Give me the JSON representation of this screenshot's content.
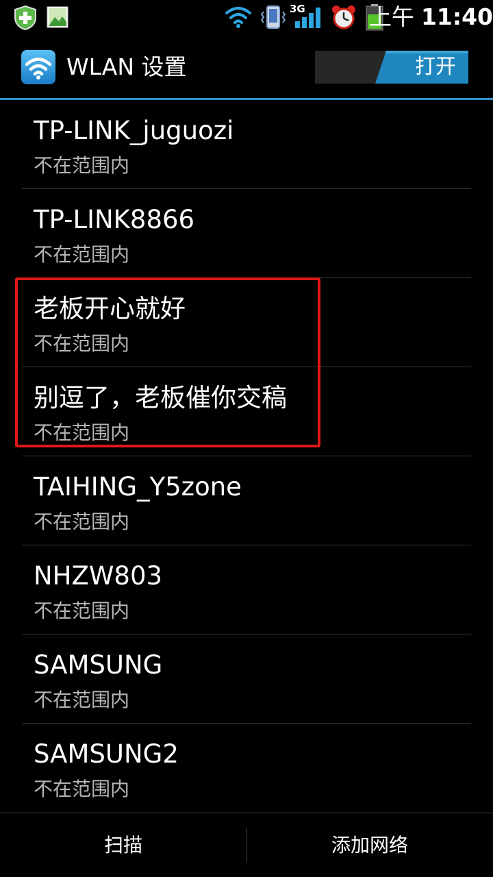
{
  "status_bar": {
    "ampm": "上午",
    "time": "11:40",
    "network_type": "3G",
    "icons": [
      "shield-update-icon",
      "image-notification-icon",
      "wifi-signal-icon",
      "vibrate-mode-icon",
      "cellular-signal-icon",
      "alarm-clock-icon",
      "battery-icon"
    ]
  },
  "action_bar": {
    "title": "WLAN 设置",
    "app_icon": "wifi-icon",
    "toggle_label": "打开",
    "toggle_state": "on"
  },
  "networks": [
    {
      "ssid": "TP-LINK_juguozi",
      "status": "不在范围内"
    },
    {
      "ssid": "TP-LINK8866",
      "status": "不在范围内"
    },
    {
      "ssid": "老板开心就好",
      "status": "不在范围内"
    },
    {
      "ssid": "别逗了，老板催你交稿",
      "status": "不在范围内"
    },
    {
      "ssid": "TAIHING_Y5zone",
      "status": "不在范围内"
    },
    {
      "ssid": "NHZW803",
      "status": "不在范围内"
    },
    {
      "ssid": "SAMSUNG",
      "status": "不在范围内"
    },
    {
      "ssid": "SAMSUNG2",
      "status": "不在范围内"
    }
  ],
  "bottom_bar": {
    "scan_label": "扫描",
    "add_network_label": "添加网络"
  },
  "colors": {
    "accent": "#2e8fc6",
    "highlight_border": "#e01818",
    "secondary_text": "#b5b5b5"
  }
}
